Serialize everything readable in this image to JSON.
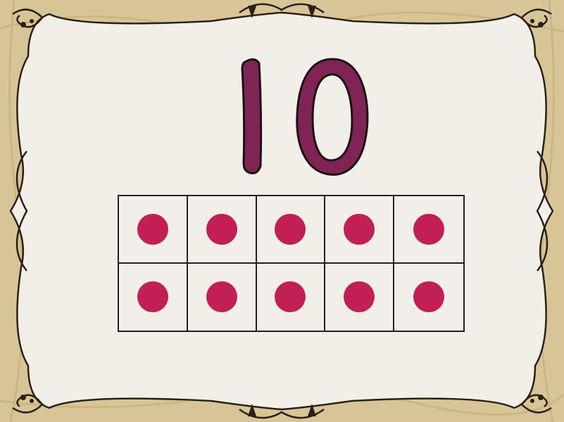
{
  "card": {
    "number": "10",
    "number_color": "#7f2455",
    "counter_color": "#c21f55",
    "parchment_color": "#f2efe8",
    "border_color": "#d9c596"
  },
  "ten_frame": {
    "rows": 2,
    "columns": 5,
    "filled": [
      true,
      true,
      true,
      true,
      true,
      true,
      true,
      true,
      true,
      true
    ]
  }
}
